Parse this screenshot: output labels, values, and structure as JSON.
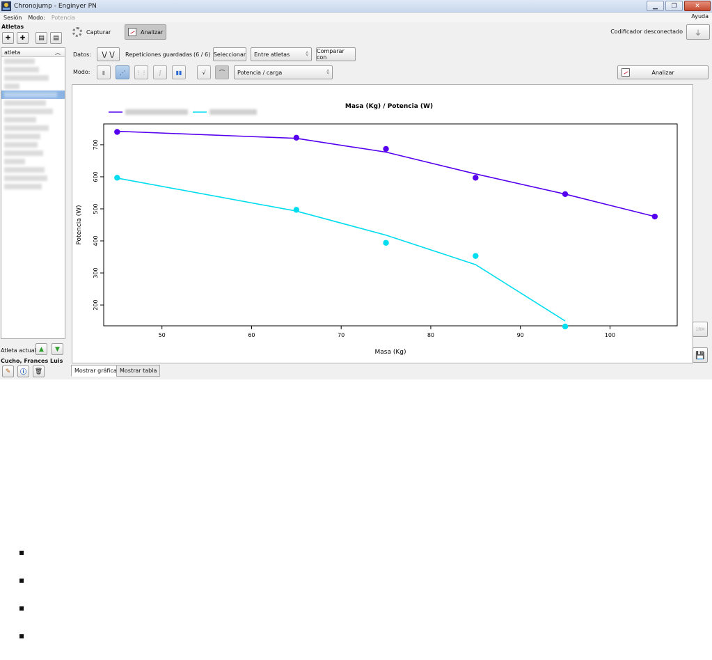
{
  "window": {
    "title": "Chronojump - Enginyer PN"
  },
  "menu": {
    "items": [
      "Sesión",
      "Modo:",
      "Potencia"
    ],
    "help": "Ayuda"
  },
  "sidebar": {
    "athletes_title": "Atletas",
    "column_header": "atleta",
    "current_athlete_label": "Atleta actual",
    "current_athlete_name": "Cucho, Frances Luis"
  },
  "toolbar": {
    "capture_label": "Capturar",
    "analyze_label": "Analizar",
    "encoder_status": "Codificador desconectado"
  },
  "data_row": {
    "data_label": "Datos:",
    "saved_label": "Repeticiones guardadas",
    "saved_count": "(6 / 6)",
    "select_button": "Seleccionar",
    "compare_combo": "Entre atletas",
    "compare_button": "Comparar con"
  },
  "mode_row": {
    "mode_label": "Modo:",
    "variable_combo": "Potencia / carga",
    "analyze_button": "Analizar"
  },
  "tabs": [
    "Mostrar gráfica",
    "Mostrar tabla"
  ],
  "side_buttons": {
    "one_rm": "1RM"
  },
  "chart_data": {
    "type": "line",
    "title": "Masa (Kg) / Potencia (W)",
    "xlabel": "Masa (Kg)",
    "ylabel": "Potencia (W)",
    "xlim": [
      43.5,
      107.5
    ],
    "ylim": [
      135,
      765
    ],
    "xticks": [
      50,
      60,
      70,
      80,
      90,
      100
    ],
    "yticks": [
      200,
      300,
      400,
      500,
      600,
      700
    ],
    "legend_position": "top-left",
    "series": [
      {
        "color": "#5500ee",
        "points_x": [
          45,
          65,
          75,
          85,
          95,
          105
        ],
        "points_y": [
          740,
          722,
          687,
          597,
          546,
          476
        ],
        "fit_x": [
          45,
          65,
          75,
          85,
          95,
          105
        ],
        "fit_y": [
          742,
          720,
          677,
          609,
          546,
          476
        ]
      },
      {
        "color": "#00ddee",
        "points_x": [
          45,
          65,
          75,
          85,
          95
        ],
        "points_y": [
          597,
          497,
          394,
          353,
          133
        ],
        "fit_x": [
          45,
          65,
          75,
          85,
          95
        ],
        "fit_y": [
          596,
          493,
          418,
          326,
          150
        ]
      }
    ]
  },
  "colors": {
    "accent": "#8bb4e4",
    "series1": "#5500ee",
    "series2": "#00ddee"
  }
}
